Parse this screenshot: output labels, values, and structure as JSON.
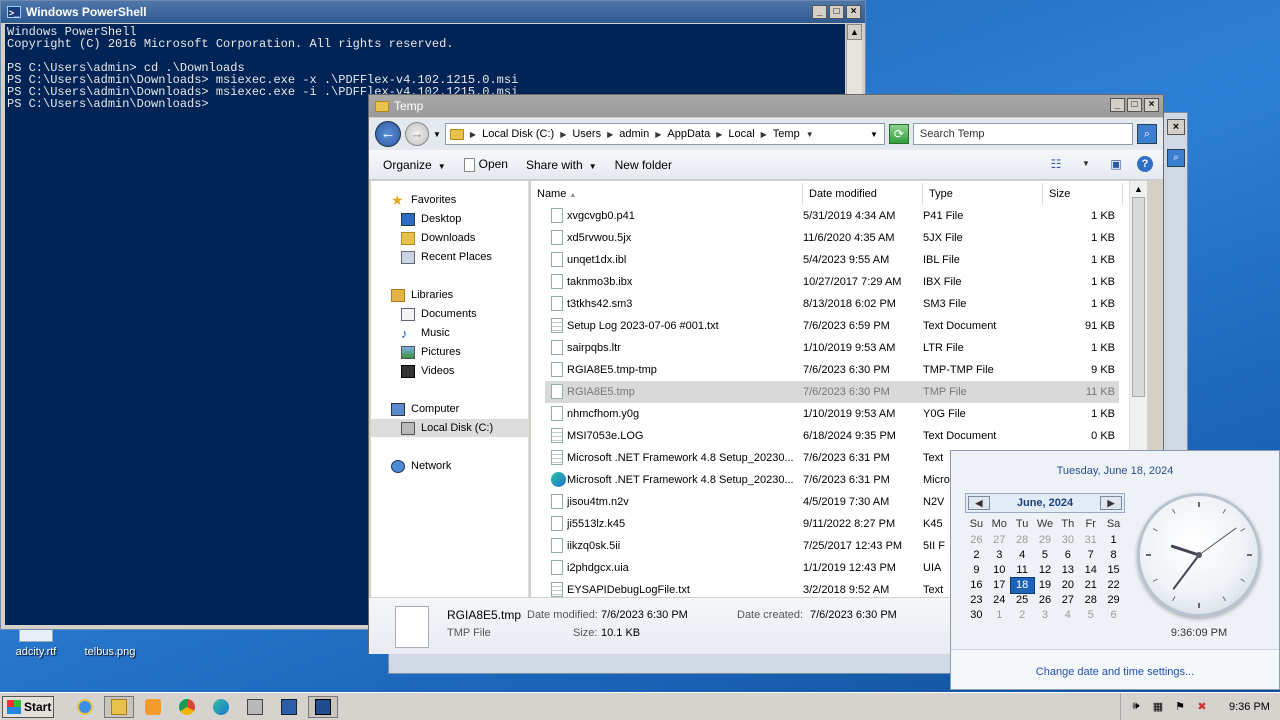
{
  "desktop_icons": [
    {
      "label": "adcity.rtf"
    },
    {
      "label": "telbus.png"
    }
  ],
  "powershell": {
    "title": "Windows PowerShell",
    "lines": [
      "Windows PowerShell",
      "Copyright (C) 2016 Microsoft Corporation. All rights reserved.",
      "",
      "PS C:\\Users\\admin> cd .\\Downloads",
      "PS C:\\Users\\admin\\Downloads> msiexec.exe -x .\\PDFFlex-v4.102.1215.0.msi",
      "PS C:\\Users\\admin\\Downloads> msiexec.exe -i .\\PDFFlex-v4.102.1215.0.msi",
      "PS C:\\Users\\admin\\Downloads>"
    ]
  },
  "explorer": {
    "title": "Temp",
    "breadcrumb": [
      "Local Disk (C:)",
      "Users",
      "admin",
      "AppData",
      "Local",
      "Temp"
    ],
    "search_placeholder": "Search Temp",
    "toolbar": {
      "organize": "Organize",
      "open": "Open",
      "share_with": "Share with",
      "new_folder": "New folder"
    },
    "nav": {
      "favorites": "Favorites",
      "desktop": "Desktop",
      "downloads": "Downloads",
      "recent_places": "Recent Places",
      "libraries": "Libraries",
      "documents": "Documents",
      "music": "Music",
      "pictures": "Pictures",
      "videos": "Videos",
      "computer": "Computer",
      "local_disk": "Local Disk (C:)",
      "network": "Network"
    },
    "columns": {
      "name": "Name",
      "date": "Date modified",
      "type": "Type",
      "size": "Size"
    },
    "files": [
      {
        "name": "xvgcvgb0.p41",
        "date": "5/31/2019 4:34 AM",
        "type": "P41 File",
        "size": "1 KB",
        "icon": "file"
      },
      {
        "name": "xd5rvwou.5jx",
        "date": "11/6/2020 4:35 AM",
        "type": "5JX File",
        "size": "1 KB",
        "icon": "file"
      },
      {
        "name": "unqet1dx.ibl",
        "date": "5/4/2023 9:55 AM",
        "type": "IBL File",
        "size": "1 KB",
        "icon": "file"
      },
      {
        "name": "taknmo3b.ibx",
        "date": "10/27/2017 7:29 AM",
        "type": "IBX File",
        "size": "1 KB",
        "icon": "file"
      },
      {
        "name": "t3tkhs42.sm3",
        "date": "8/13/2018 6:02 PM",
        "type": "SM3 File",
        "size": "1 KB",
        "icon": "file"
      },
      {
        "name": "Setup Log 2023-07-06 #001.txt",
        "date": "7/6/2023 6:59 PM",
        "type": "Text Document",
        "size": "91 KB",
        "icon": "txt"
      },
      {
        "name": "sairpqbs.ltr",
        "date": "1/10/2019 9:53 AM",
        "type": "LTR File",
        "size": "1 KB",
        "icon": "file"
      },
      {
        "name": "RGIA8E5.tmp-tmp",
        "date": "7/6/2023 6:30 PM",
        "type": "TMP-TMP File",
        "size": "9 KB",
        "icon": "file"
      },
      {
        "name": "RGIA8E5.tmp",
        "date": "7/6/2023 6:30 PM",
        "type": "TMP File",
        "size": "11 KB",
        "icon": "file",
        "selected": true
      },
      {
        "name": "nhmcfhom.y0g",
        "date": "1/10/2019 9:53 AM",
        "type": "Y0G File",
        "size": "1 KB",
        "icon": "file"
      },
      {
        "name": "MSI7053e.LOG",
        "date": "6/18/2024 9:35 PM",
        "type": "Text Document",
        "size": "0 KB",
        "icon": "txt"
      },
      {
        "name": "Microsoft .NET Framework 4.8 Setup_20230...",
        "date": "7/6/2023 6:31 PM",
        "type": "Text",
        "size": "",
        "icon": "txt"
      },
      {
        "name": "Microsoft .NET Framework 4.8 Setup_20230...",
        "date": "7/6/2023 6:31 PM",
        "type": "Micro",
        "size": "",
        "icon": "edge"
      },
      {
        "name": "jisou4tm.n2v",
        "date": "4/5/2019 7:30 AM",
        "type": "N2V",
        "size": "",
        "icon": "file"
      },
      {
        "name": "ji5513lz.k45",
        "date": "9/11/2022 8:27 PM",
        "type": "K45",
        "size": "",
        "icon": "file"
      },
      {
        "name": "iikzq0sk.5ii",
        "date": "7/25/2017 12:43 PM",
        "type": "5II F",
        "size": "",
        "icon": "file"
      },
      {
        "name": "i2phdgcx.uia",
        "date": "1/1/2019 12:43 PM",
        "type": "UIA",
        "size": "",
        "icon": "file"
      },
      {
        "name": "EYSAPIDebugLogFile.txt",
        "date": "3/2/2018 9:52 AM",
        "type": "Text",
        "size": "",
        "icon": "txt"
      }
    ],
    "details": {
      "name": "RGIA8E5.tmp",
      "modified_label": "Date modified:",
      "modified": "7/6/2023 6:30 PM",
      "created_label": "Date created:",
      "created": "7/6/2023 6:30 PM",
      "type": "TMP File",
      "size_label": "Size:",
      "size": "10.1 KB"
    }
  },
  "calendar": {
    "full_date": "Tuesday, June 18, 2024",
    "month": "June, 2024",
    "weekdays": [
      "Su",
      "Mo",
      "Tu",
      "We",
      "Th",
      "Fr",
      "Sa"
    ],
    "days": [
      [
        "26",
        "m"
      ],
      [
        "27",
        "m"
      ],
      [
        "28",
        "m"
      ],
      [
        "29",
        "m"
      ],
      [
        "30",
        "m"
      ],
      [
        "31",
        "m"
      ],
      [
        "1",
        ""
      ],
      [
        "2",
        ""
      ],
      [
        "3",
        ""
      ],
      [
        "4",
        ""
      ],
      [
        "5",
        ""
      ],
      [
        "6",
        ""
      ],
      [
        "7",
        ""
      ],
      [
        "8",
        ""
      ],
      [
        "9",
        ""
      ],
      [
        "10",
        ""
      ],
      [
        "11",
        ""
      ],
      [
        "12",
        ""
      ],
      [
        "13",
        ""
      ],
      [
        "14",
        ""
      ],
      [
        "15",
        ""
      ],
      [
        "16",
        ""
      ],
      [
        "17",
        ""
      ],
      [
        "18",
        "t"
      ],
      [
        "19",
        ""
      ],
      [
        "20",
        ""
      ],
      [
        "21",
        ""
      ],
      [
        "22",
        ""
      ],
      [
        "23",
        ""
      ],
      [
        "24",
        ""
      ],
      [
        "25",
        ""
      ],
      [
        "26",
        ""
      ],
      [
        "27",
        ""
      ],
      [
        "28",
        ""
      ],
      [
        "29",
        ""
      ],
      [
        "30",
        ""
      ],
      [
        "1",
        "m"
      ],
      [
        "2",
        "m"
      ],
      [
        "3",
        "m"
      ],
      [
        "4",
        "m"
      ],
      [
        "5",
        "m"
      ],
      [
        "6",
        "m"
      ]
    ],
    "clock_time": "9:36:09 PM",
    "clock_hands": {
      "hour": 9,
      "minute": 36,
      "second": 9
    },
    "settings_link": "Change date and time settings..."
  },
  "taskbar": {
    "start": "Start",
    "time": "9:36 PM"
  }
}
